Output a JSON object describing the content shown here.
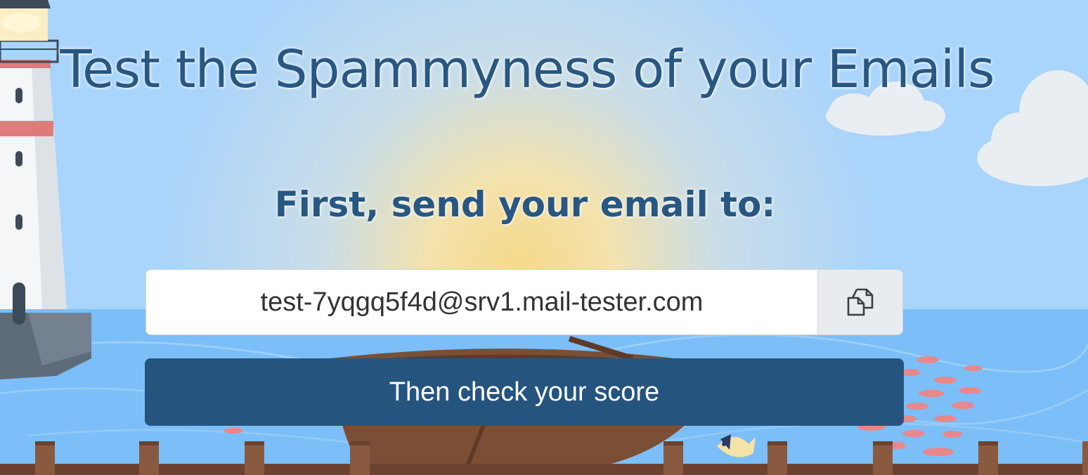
{
  "hero": {
    "title": "Test the Spammyness of your Emails",
    "instruction": "First, send your email to:"
  },
  "address_field": {
    "value": "test-7yqgq5f4d@srv1.mail-tester.com",
    "copy_icon": "copy-icon"
  },
  "actions": {
    "check_label": "Then check your score"
  },
  "colors": {
    "brand_blue": "#25557f",
    "title_blue": "#285782",
    "sky": "#a9d4fb",
    "sea": "#7cbef7"
  }
}
